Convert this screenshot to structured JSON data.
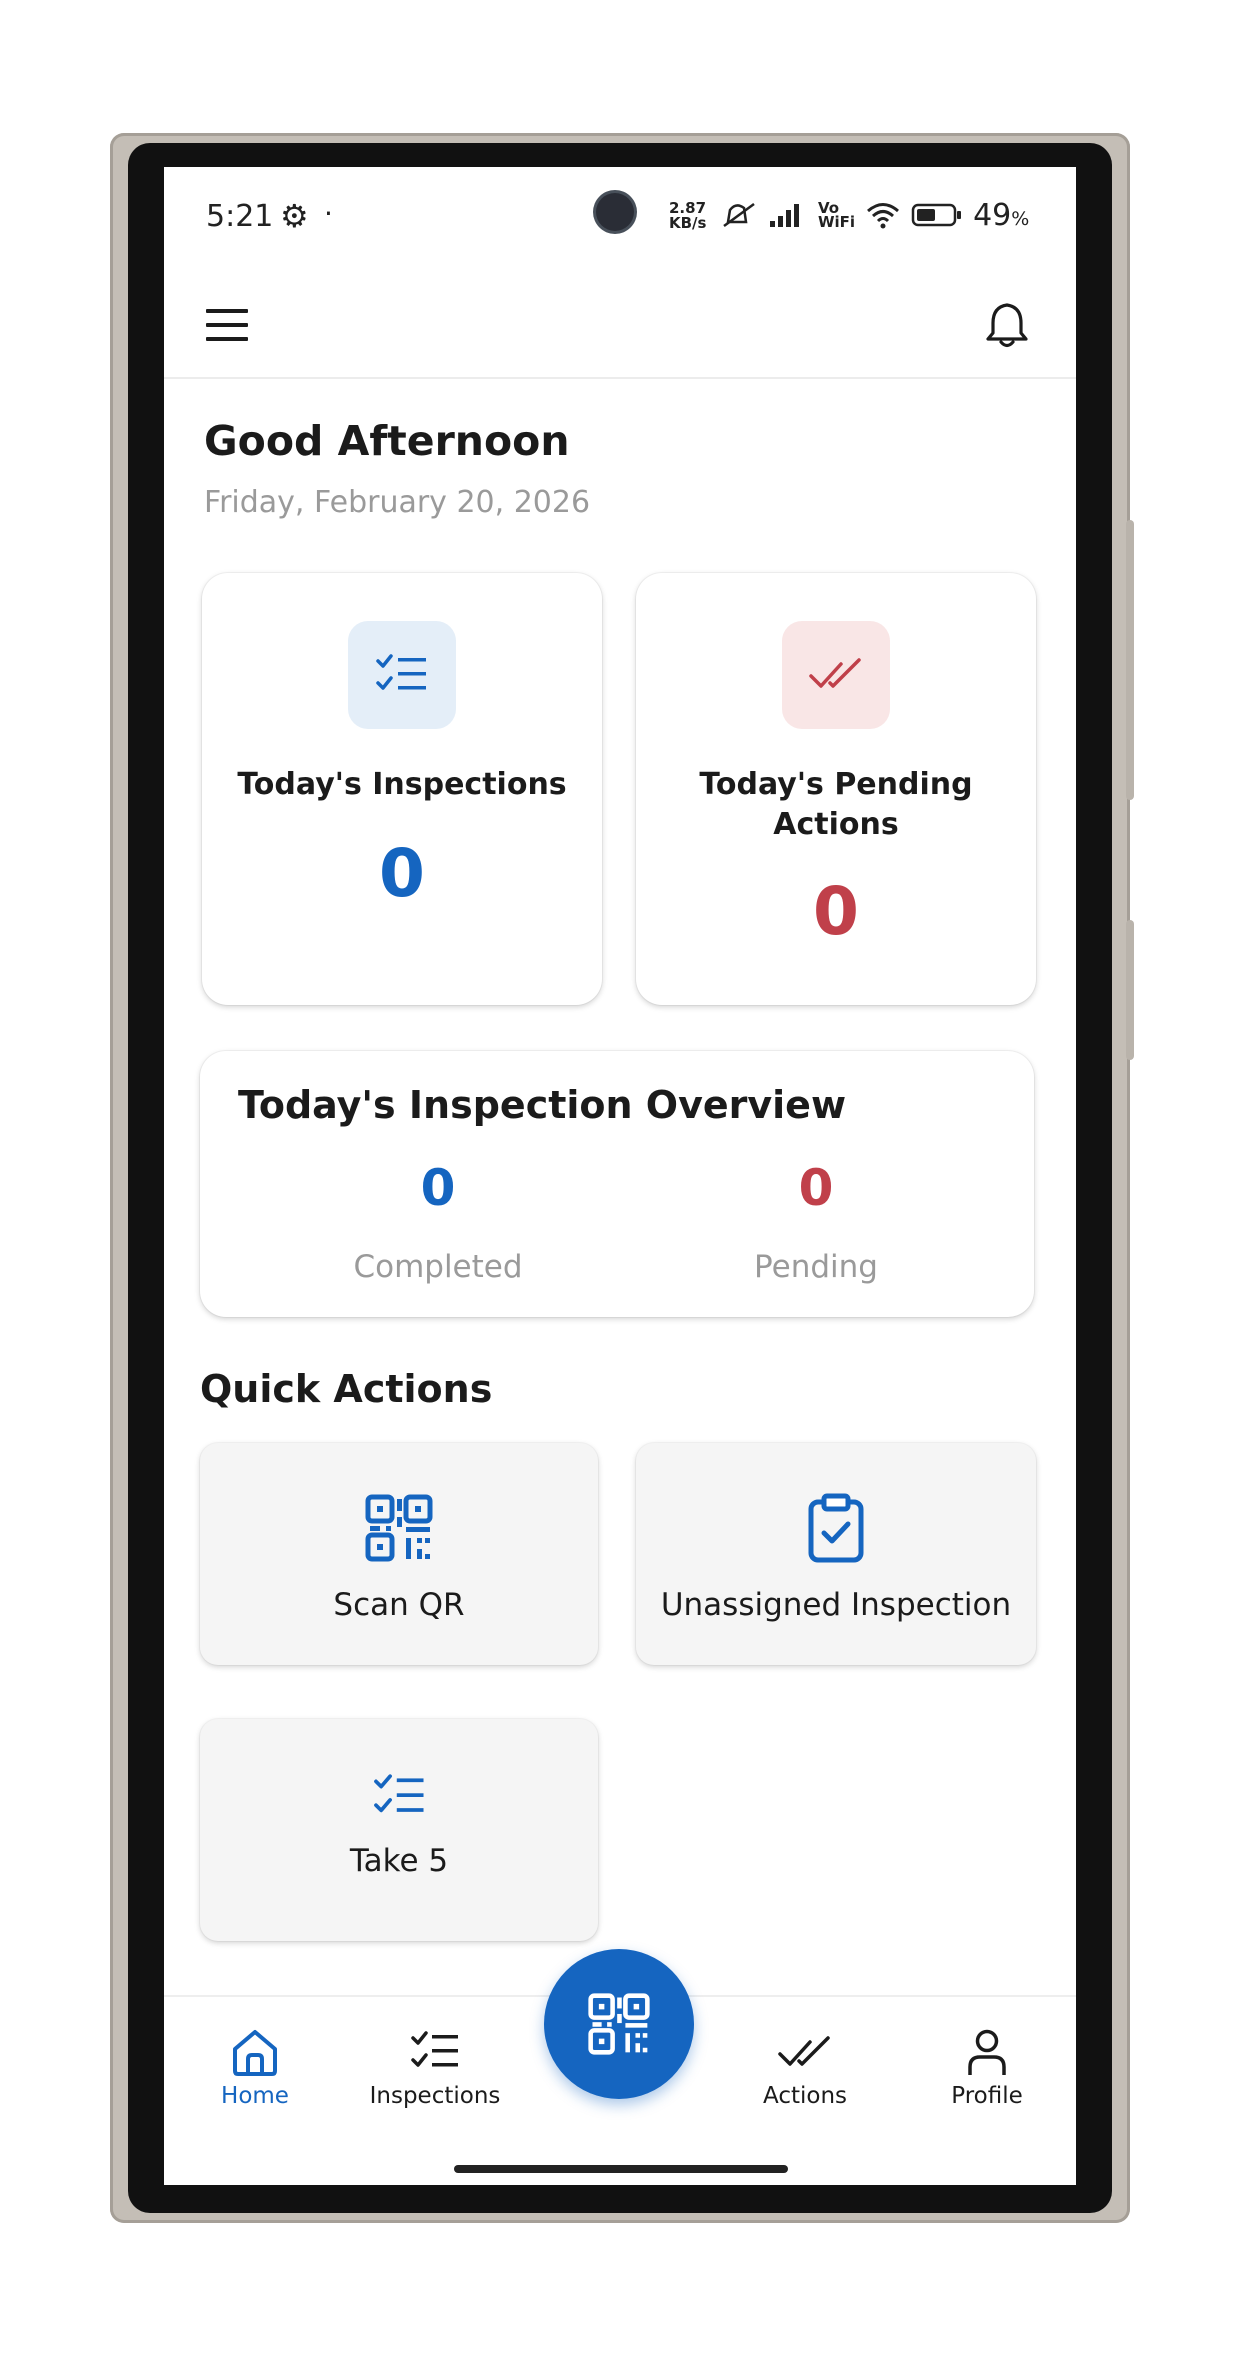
{
  "colors": {
    "accent_blue": "#1565c0",
    "accent_red": "#c0404a",
    "blue_icon_bg": "#e4eef8",
    "red_icon_bg": "#f9e6e6",
    "muted_text": "#9a9a9a"
  },
  "status_bar": {
    "time": "5:21",
    "settings_icon": "gear-icon",
    "speed_value": "2.87",
    "speed_unit": "KB/s",
    "network_label_top": "Vo",
    "network_label_bottom": "WiFi",
    "battery_percent": "49",
    "battery_unit": "%"
  },
  "app_bar": {
    "menu_icon": "menu-icon",
    "notification_icon": "bell-icon"
  },
  "header": {
    "greeting": "Good Afternoon",
    "date": "Friday, February 20, 2026"
  },
  "stats": {
    "inspections": {
      "label": "Today's Inspections",
      "value": "0",
      "icon": "checklist-icon"
    },
    "pending_actions": {
      "label_line1": "Today's Pending",
      "label_line2": "Actions",
      "value": "0",
      "icon": "double-check-icon"
    }
  },
  "overview": {
    "title": "Today's Inspection Overview",
    "completed_value": "0",
    "completed_label": "Completed",
    "pending_value": "0",
    "pending_label": "Pending"
  },
  "quick_actions": {
    "title": "Quick Actions",
    "items": [
      {
        "label": "Scan QR",
        "icon": "qr-code-icon"
      },
      {
        "label": "Unassigned Inspection",
        "icon": "clipboard-check-icon"
      },
      {
        "label": "Take 5",
        "icon": "checklist-icon"
      }
    ]
  },
  "bottom_nav": {
    "items": [
      {
        "label": "Home",
        "icon": "home-icon",
        "active": true
      },
      {
        "label": "Inspections",
        "icon": "checklist-icon",
        "active": false
      },
      {
        "label": "Actions",
        "icon": "double-check-icon",
        "active": false
      },
      {
        "label": "Profile",
        "icon": "person-icon",
        "active": false
      }
    ],
    "fab_icon": "qr-code-icon"
  }
}
